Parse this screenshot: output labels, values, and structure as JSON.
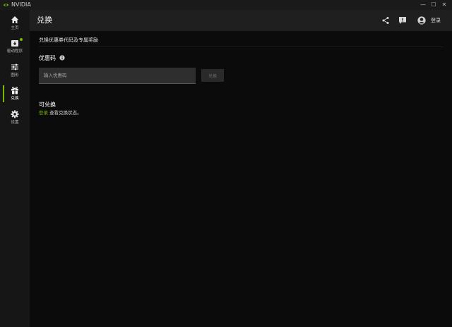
{
  "app": {
    "title": "NVIDIA"
  },
  "window": {
    "minimize_glyph": "—",
    "maximize_glyph": "☐",
    "close_glyph": "✕"
  },
  "sidebar": {
    "items": [
      {
        "label": "主页",
        "icon": "home-icon"
      },
      {
        "label": "驱动程序",
        "icon": "driver-icon",
        "badge": true
      },
      {
        "label": "图形",
        "icon": "sliders-icon"
      },
      {
        "label": "兑换",
        "icon": "gift-icon",
        "active": true
      },
      {
        "label": "设置",
        "icon": "gear-icon"
      }
    ]
  },
  "header": {
    "title": "兑换",
    "login_label": "登录",
    "icons": [
      "share-icon",
      "feedback-icon",
      "user-avatar-icon"
    ]
  },
  "main": {
    "subtitle": "兑换优惠券代码及专属奖励",
    "promo_label": "优惠码",
    "promo_input": {
      "placeholder": "输入优惠码",
      "value": ""
    },
    "redeem_button": "兑换",
    "status_title": "可兑换",
    "status_link": "登录",
    "status_text": " 查看兑换状态。"
  },
  "colors": {
    "accent": "#76b900",
    "background": "#0b0b0b",
    "header": "#1f1f1f",
    "sidebar": "#161616",
    "input": "#2e2e2e"
  }
}
